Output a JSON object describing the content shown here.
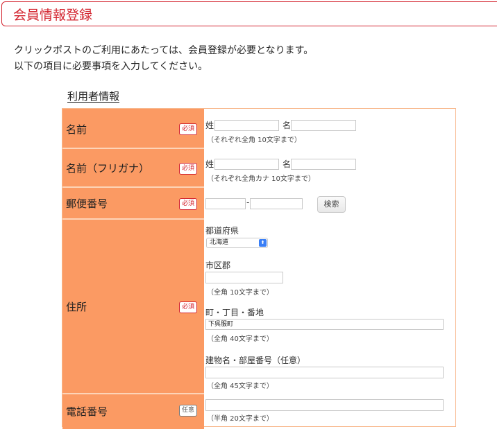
{
  "page": {
    "title": "会員情報登録",
    "intro_line1": "クリックポストのご利用にあたっては、会員登録が必要となります。",
    "intro_line2": "以下の項目に必要事項を入力してください。"
  },
  "section": {
    "title": "利用者情報"
  },
  "badges": {
    "required": "必須",
    "optional": "任意"
  },
  "rows": {
    "name": {
      "label": "名前",
      "sei_label": "姓",
      "mei_label": "名",
      "sei_value": "",
      "mei_value": "",
      "note": "（それぞれ全角 10文字まで）"
    },
    "name_kana": {
      "label": "名前（フリガナ）",
      "sei_label": "姓",
      "mei_label": "名",
      "sei_value": "",
      "mei_value": "",
      "note": "（それぞれ全角カナ 10文字まで）"
    },
    "postal": {
      "label": "郵便番号",
      "part1": "",
      "part2": "",
      "dash": "-",
      "search_button": "検索"
    },
    "address": {
      "label": "住所",
      "prefecture_label": "都道府県",
      "prefecture_value": "北海道",
      "city_label": "市区郡",
      "city_value": "",
      "city_note": "（全角 10文字まで）",
      "street_label": "町・丁目・番地",
      "street_value": "下呉服町",
      "street_note": "（全角 40文字まで）",
      "building_label": "建物名・部屋番号（任意）",
      "building_value": "",
      "building_note": "（全角 45文字まで）"
    },
    "phone": {
      "label": "電話番号",
      "value": "",
      "note": "（半角 20文字まで）"
    }
  },
  "colors": {
    "accent": "#d3232e",
    "label_bg": "#fb9a63",
    "border": "#f8b88d"
  }
}
